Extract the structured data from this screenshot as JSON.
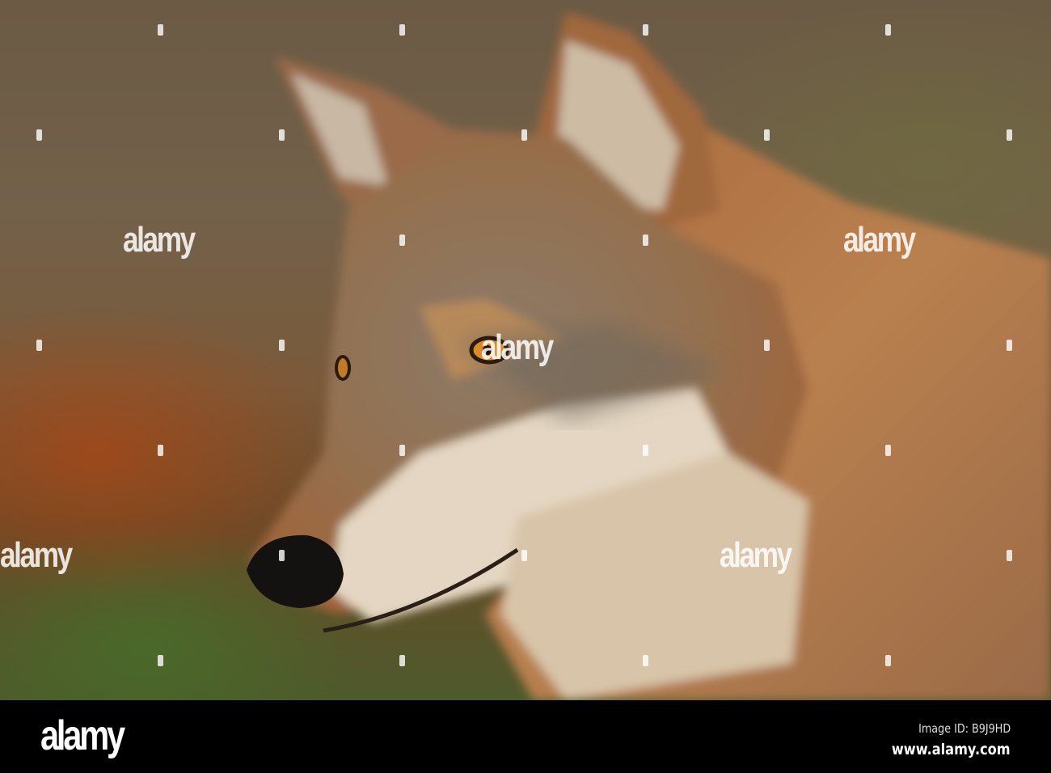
{
  "photo": {
    "subject": "wolf-portrait",
    "watermark_text": "alamy",
    "colors": {
      "fur_orange": "#b8703a",
      "fur_gray": "#8a7a68",
      "muzzle_cream": "#e8dccb",
      "nose": "#141210",
      "eye": "#d98a2a"
    }
  },
  "footer": {
    "logo": "alamy",
    "image_id": "Image ID: B9J9HD",
    "website": "www.alamy.com"
  }
}
